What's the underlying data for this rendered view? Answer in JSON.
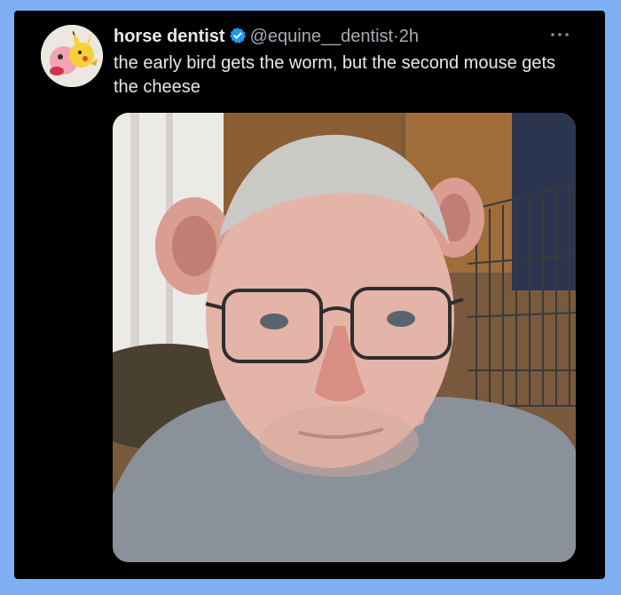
{
  "tweet": {
    "display_name": "horse dentist",
    "handle": "@equine__dentist",
    "separator": "·",
    "time": "2h",
    "text": "the early bird gets the worm, but the second mouse gets the cheese",
    "more_icon": "ellipsis-icon",
    "verified_icon": "verified-badge-icon"
  },
  "colors": {
    "background": "#7fb0f5",
    "card": "#000000",
    "verified": "#1d9bf0",
    "secondary_text": "#a7adb3"
  }
}
